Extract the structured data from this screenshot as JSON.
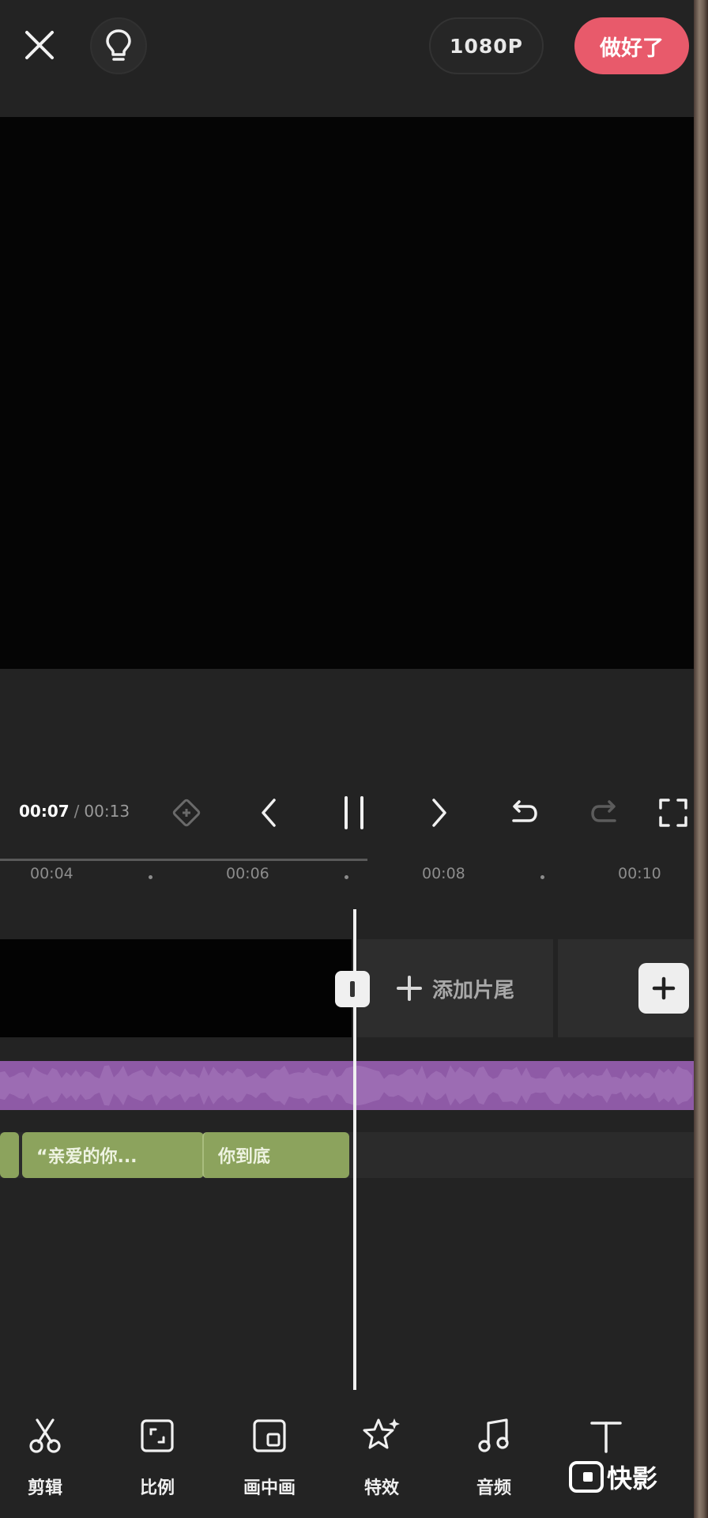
{
  "topbar": {
    "resolution_label": "1080P",
    "done_label": "做好了",
    "close_icon": "close-icon",
    "tips_icon": "lightbulb-icon"
  },
  "playback": {
    "current_time": "00:07",
    "separator": "/",
    "total_time": "00:13"
  },
  "ruler": {
    "ticks": [
      "00:04",
      "00:06",
      "00:08",
      "00:10"
    ]
  },
  "tracks": {
    "add_ending_label": "添加片尾",
    "text_clips": [
      "“亲爱的你...",
      "你到底"
    ]
  },
  "toolbar": {
    "items": [
      {
        "label": "剪辑",
        "icon": "scissors-icon"
      },
      {
        "label": "比例",
        "icon": "aspect-ratio-icon"
      },
      {
        "label": "画中画",
        "icon": "picture-in-picture-icon"
      },
      {
        "label": "特效",
        "icon": "sparkle-star-icon"
      },
      {
        "label": "音频",
        "icon": "music-note-icon"
      },
      {
        "label": "",
        "icon": "text-icon"
      }
    ]
  },
  "watermark": {
    "text": "快影"
  },
  "colors": {
    "background": "#232323",
    "accent": "#e85a6b",
    "audio_track": "#8e5aa6",
    "text_clip": "#8ca35d"
  }
}
